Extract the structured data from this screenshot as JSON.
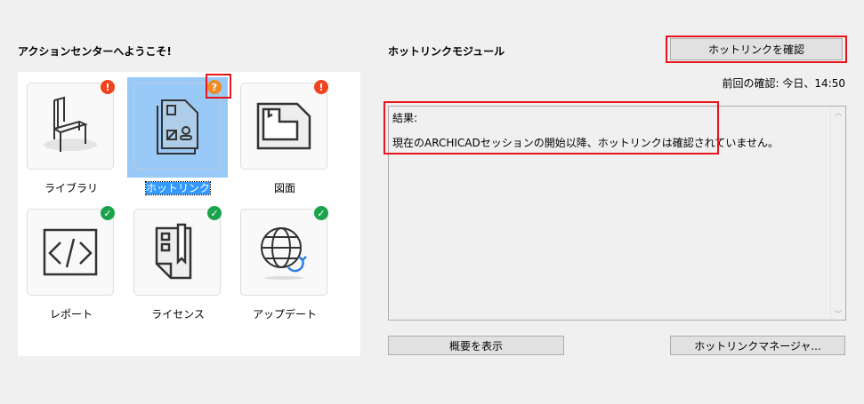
{
  "left": {
    "title": "アクションセンターへようこそ!",
    "tiles": [
      {
        "label": "ライブラリ",
        "status": "error"
      },
      {
        "label": "ホットリンク",
        "status": "unknown"
      },
      {
        "label": "図面",
        "status": "error"
      },
      {
        "label": "レポート",
        "status": "ok"
      },
      {
        "label": "ライセンス",
        "status": "ok"
      },
      {
        "label": "アップデート",
        "status": "ok"
      }
    ],
    "badges": {
      "error": "!",
      "unknown": "?",
      "ok": "✓"
    }
  },
  "right": {
    "title": "ホットリンクモジュール",
    "check_button": "ホットリンクを確認",
    "last_check": "前回の確認: 今日、14:50",
    "result_heading": "結果:",
    "result_text": "現在のARCHICADセッションの開始以降、ホットリンクは確認されていません。",
    "summary_button": "概要を表示",
    "manager_button": "ホットリンクマネージャ..."
  },
  "colors": {
    "error": "#f0421c",
    "unknown": "#f08a24",
    "ok": "#1aa34a",
    "selection": "#99c9f7"
  }
}
